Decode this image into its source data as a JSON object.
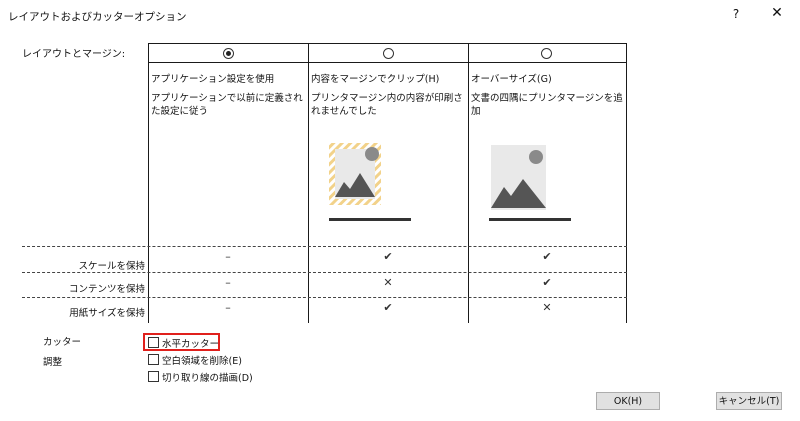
{
  "window": {
    "title": "レイアウトおよびカッターオプション",
    "help_label": "?",
    "close_label": "✕"
  },
  "layout_margin": {
    "label": "レイアウトとマージン:",
    "options": [
      {
        "name": "アプリケーション設定を使用",
        "description": "アプリケーションで以前に定義された設定に従う",
        "selected": true
      },
      {
        "name": "内容をマージンでクリップ(H)",
        "description": "プリンタマージン内の内容が印刷されませんでした",
        "selected": false
      },
      {
        "name": "オーバーサイズ(G)",
        "description": "文書の四隅にプリンタマージンを追加",
        "selected": false
      }
    ],
    "rows": [
      {
        "label": "スケールを保持",
        "values": [
          "–",
          "✔",
          "✔"
        ]
      },
      {
        "label": "コンテンツを保持",
        "values": [
          "–",
          "✕",
          "✔"
        ]
      },
      {
        "label": "用紙サイズを保持",
        "values": [
          "–",
          "✔",
          "✕"
        ]
      }
    ],
    "icons": [
      "image-clip-preview-icon",
      "image-oversize-preview-icon"
    ]
  },
  "cutter": {
    "label": "カッター",
    "horizontal_cutter": {
      "label": "水平カッター",
      "checked": false
    }
  },
  "adjust": {
    "label": "調整",
    "remove_blank": {
      "label": "空白領域を削除(E)",
      "checked": false
    },
    "draw_cut_lines": {
      "label": "切り取り線の描画(D)",
      "checked": false
    }
  },
  "buttons": {
    "ok": "OK(H)",
    "cancel": "キャンセル(T)"
  },
  "colors": {
    "highlight": "#e0201c",
    "image_gray": "#555555",
    "clip_stripe": "#f2d28a"
  }
}
